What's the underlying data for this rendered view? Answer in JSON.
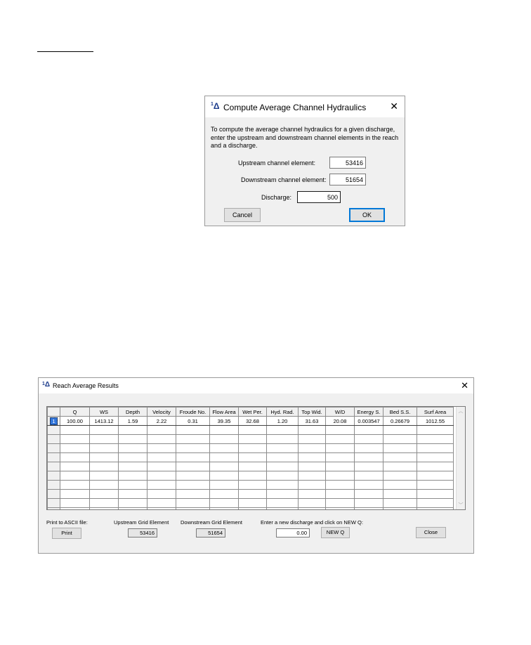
{
  "dialog1": {
    "title": "Compute Average Channel Hydraulics",
    "close": "✕",
    "description": "To compute the average channel hydraulics for a given discharge, enter the upstream and downstream channel elements in the reach and a discharge.",
    "upstream_label": "Upstream channel element:",
    "upstream_value": "53416",
    "downstream_label": "Downstream channel element:",
    "downstream_value": "51654",
    "discharge_label": "Discharge:",
    "discharge_value": "500",
    "cancel_label": "Cancel",
    "ok_label": "OK"
  },
  "dialog2": {
    "title": "Reach Average Results",
    "close": "✕",
    "columns": [
      "",
      "Q",
      "WS",
      "Depth",
      "Velocity",
      "Froude No.",
      "Flow Area",
      "Wet Per.",
      "Hyd. Rad.",
      "Top Wid.",
      "W/D",
      "Energy S.",
      "Bed S.S.",
      "Surf Area"
    ],
    "first_row": [
      "1",
      "100.00",
      "1413.12",
      "1.59",
      "2.22",
      "0.31",
      "39.35",
      "32.68",
      "1.20",
      "31.63",
      "20.08",
      "0.003547",
      "0.26679",
      "1012.55"
    ],
    "empty_rows": 10,
    "print_label": "Print to ASCII file:",
    "print_button": "Print",
    "upstream_label": "Upstream Grid Element",
    "upstream_value": "53416",
    "downstream_label": "Downstream Grid Element",
    "downstream_value": "51654",
    "newq_label": "Enter a new discharge and click on NEW Q:",
    "newq_value": "0.00",
    "newq_button": "NEW Q",
    "close_button": "Close"
  }
}
